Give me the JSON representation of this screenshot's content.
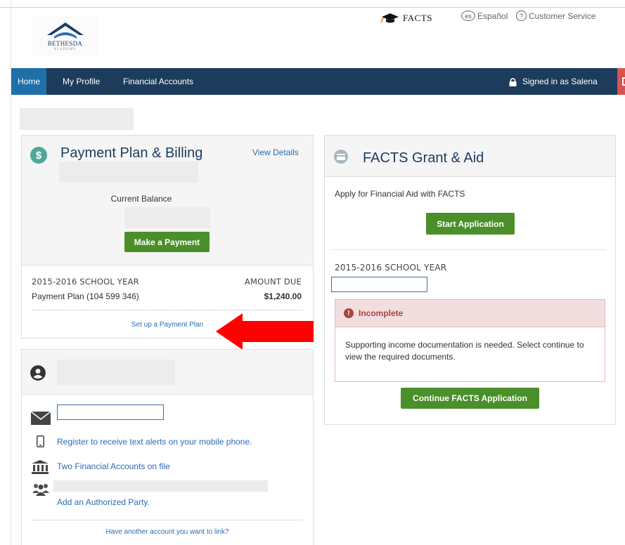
{
  "brand": {
    "school_name": "BETHESDA",
    "school_sub": "ACADEMY",
    "facts_label": "FACTS"
  },
  "utility": {
    "es_icon": "es",
    "language_label": "Español",
    "help_icon": "?",
    "customer_service_label": "Customer Service"
  },
  "nav": {
    "items": [
      {
        "label": "Home",
        "active": true
      },
      {
        "label": "My Profile",
        "active": false
      },
      {
        "label": "Financial Accounts",
        "active": false
      }
    ],
    "signed_in_label": "Signed in as Salena"
  },
  "payment": {
    "dollar_icon": "$",
    "title": "Payment Plan & Billing",
    "view_details": "View Details",
    "current_balance_label": "Current Balance",
    "make_payment_button": "Make a Payment",
    "school_year": "2015-2016 SCHOOL YEAR",
    "amount_due_header": "AMOUNT DUE",
    "plan_label": "Payment Plan (104 599 346)",
    "plan_amount": "$1,240.00",
    "setup_link": "Set up a Payment Plan"
  },
  "grant": {
    "title": "FACTS Grant & Aid",
    "apply_text": "Apply for Financial Aid with FACTS",
    "start_button": "Start Application",
    "school_year": "2015-2016 SCHOOL YEAR",
    "alert_icon": "!",
    "status_label": "Incomplete",
    "status_message": "Supporting income documentation is needed. Select continue to view the required documents.",
    "continue_button": "Continue FACTS Application"
  },
  "profile": {
    "text_alerts_link": "Register to receive text alerts on your mobile phone.",
    "financial_accounts_link": "Two Financial Accounts on file",
    "add_party_link": "Add an Authorized Party.",
    "link_account": "Have another account you want to link?"
  },
  "colors": {
    "nav_bg": "#1d3b5c",
    "nav_active": "#1f6fa8",
    "button_green": "#4a8f2a",
    "link_blue": "#2a6db0",
    "logout_red": "#d9534f",
    "alert_red": "#a94442",
    "annotation_arrow": "#ff0000"
  },
  "icons": [
    "graduation-cap-icon",
    "language-icon",
    "help-icon",
    "lock-icon",
    "logout-icon",
    "dollar-icon",
    "credit-card-icon",
    "alert-icon",
    "person-icon",
    "envelope-icon",
    "mobile-phone-icon",
    "bank-icon",
    "people-icon"
  ]
}
